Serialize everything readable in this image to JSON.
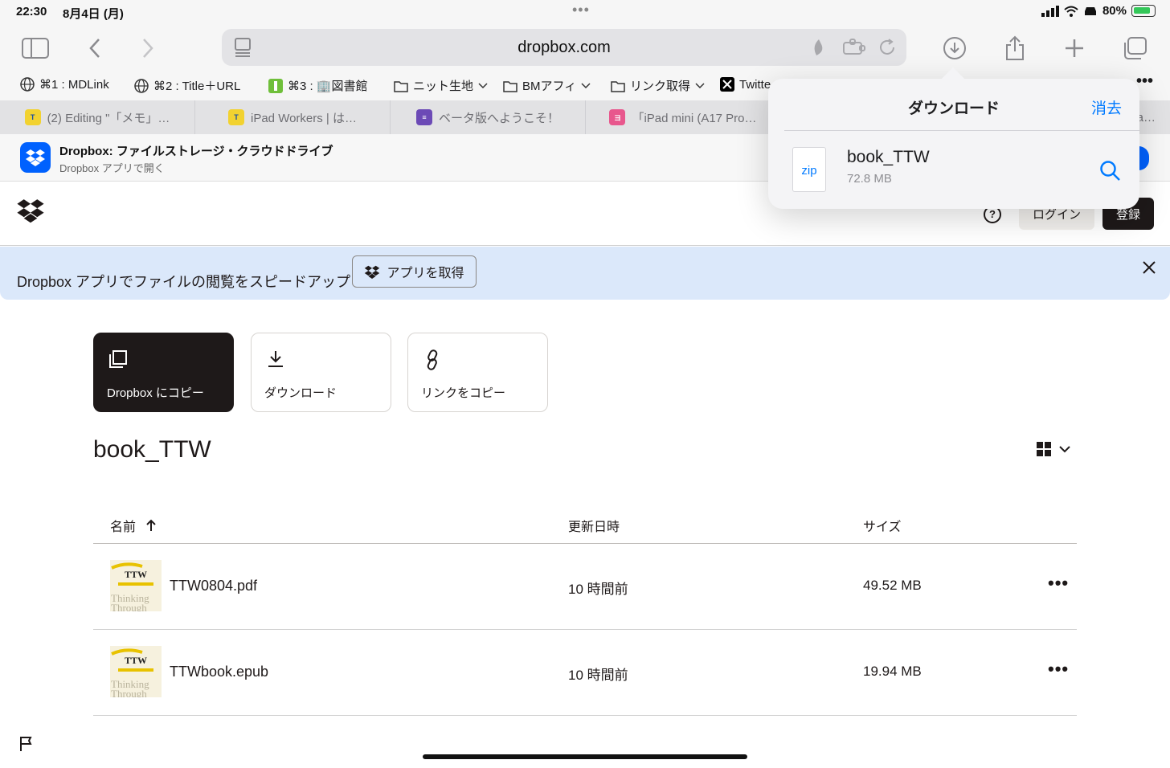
{
  "status_bar": {
    "time": "22:30",
    "date": "8月4日 (月)",
    "battery": "80%"
  },
  "toolbar": {
    "url": "dropbox.com"
  },
  "bookmarks": [
    {
      "label": "⌘1 : MDLink"
    },
    {
      "label": "⌘2 : Title＋URL"
    },
    {
      "label": "⌘3 : 🏢図書館"
    },
    {
      "label": "ニット生地"
    },
    {
      "label": "BMアフィ"
    },
    {
      "label": "リンク取得"
    },
    {
      "label": "Twitte"
    }
  ],
  "tabs": [
    {
      "label": "(2) Editing \"「メモ」…"
    },
    {
      "label": "iPad Workers | は…"
    },
    {
      "label": "ベータ版へようこそ！"
    },
    {
      "label": "「iPad mini (A17 Pro…"
    },
    {
      "label": ""
    },
    {
      "label": "a…"
    }
  ],
  "app_banner": {
    "title": "Dropbox: ファイルストレージ・クラウドドライブ",
    "subtitle": "Dropbox アプリで開く"
  },
  "header": {
    "help": "?",
    "login": "ログイン",
    "signup": "登録"
  },
  "promo": {
    "text": "Dropbox アプリでファイルの閲覧をスピードアップ",
    "button": "アプリを取得"
  },
  "actions": {
    "copy": "Dropbox にコピー",
    "download": "ダウンロード",
    "copy_link": "リンクをコピー"
  },
  "folder": {
    "name": "book_TTW"
  },
  "table": {
    "headers": {
      "name": "名前",
      "modified": "更新日時",
      "size": "サイズ"
    },
    "rows": [
      {
        "name": "TTW0804.pdf",
        "modified": "10 時間前",
        "size": "49.52 MB"
      },
      {
        "name": "TTWbook.epub",
        "modified": "10 時間前",
        "size": "19.94 MB"
      }
    ]
  },
  "thumb_text": {
    "line1": "TTW",
    "line2": "Thinking",
    "line3": "Through"
  },
  "downloads_popover": {
    "title": "ダウンロード",
    "clear": "消去",
    "file": {
      "name": "book_TTW",
      "size": "72.8 MB",
      "type": "zip"
    }
  },
  "colors": {
    "dropbox_blue": "#0061fe",
    "ios_blue": "#007aff",
    "promo_bg": "#dbe8fa",
    "dark": "#1e1919"
  },
  "icons": [
    "sidebar-icon",
    "back-icon",
    "forward-icon",
    "reader-icon",
    "extension-icon",
    "reload-icon",
    "downloads-icon",
    "share-icon",
    "new-tab-icon",
    "tabs-overview-icon",
    "globe-icon",
    "folder-icon",
    "zip-file-icon",
    "magnifier-icon",
    "grid-view-icon",
    "flag-icon"
  ]
}
